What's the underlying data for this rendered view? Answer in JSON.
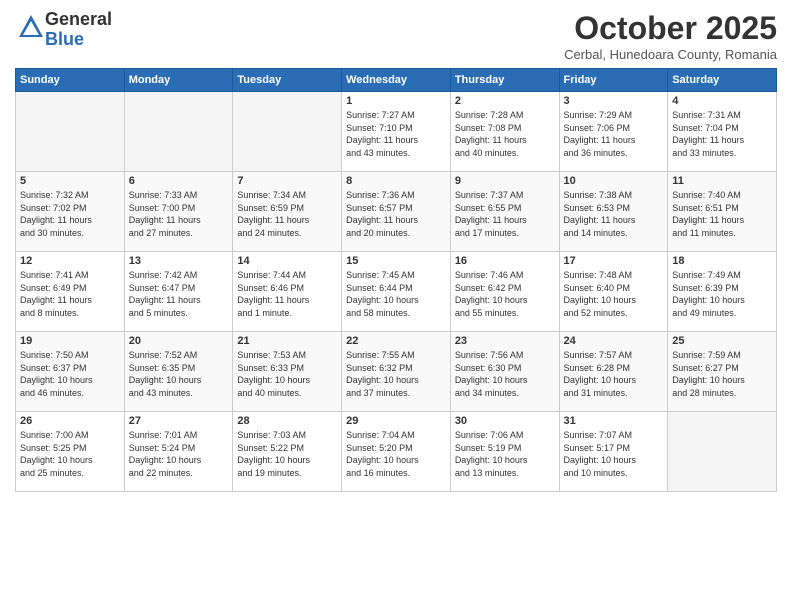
{
  "logo": {
    "general": "General",
    "blue": "Blue"
  },
  "title": "October 2025",
  "subtitle": "Cerbal, Hunedoara County, Romania",
  "headers": [
    "Sunday",
    "Monday",
    "Tuesday",
    "Wednesday",
    "Thursday",
    "Friday",
    "Saturday"
  ],
  "weeks": [
    [
      {
        "num": "",
        "info": ""
      },
      {
        "num": "",
        "info": ""
      },
      {
        "num": "",
        "info": ""
      },
      {
        "num": "1",
        "info": "Sunrise: 7:27 AM\nSunset: 7:10 PM\nDaylight: 11 hours\nand 43 minutes."
      },
      {
        "num": "2",
        "info": "Sunrise: 7:28 AM\nSunset: 7:08 PM\nDaylight: 11 hours\nand 40 minutes."
      },
      {
        "num": "3",
        "info": "Sunrise: 7:29 AM\nSunset: 7:06 PM\nDaylight: 11 hours\nand 36 minutes."
      },
      {
        "num": "4",
        "info": "Sunrise: 7:31 AM\nSunset: 7:04 PM\nDaylight: 11 hours\nand 33 minutes."
      }
    ],
    [
      {
        "num": "5",
        "info": "Sunrise: 7:32 AM\nSunset: 7:02 PM\nDaylight: 11 hours\nand 30 minutes."
      },
      {
        "num": "6",
        "info": "Sunrise: 7:33 AM\nSunset: 7:00 PM\nDaylight: 11 hours\nand 27 minutes."
      },
      {
        "num": "7",
        "info": "Sunrise: 7:34 AM\nSunset: 6:59 PM\nDaylight: 11 hours\nand 24 minutes."
      },
      {
        "num": "8",
        "info": "Sunrise: 7:36 AM\nSunset: 6:57 PM\nDaylight: 11 hours\nand 20 minutes."
      },
      {
        "num": "9",
        "info": "Sunrise: 7:37 AM\nSunset: 6:55 PM\nDaylight: 11 hours\nand 17 minutes."
      },
      {
        "num": "10",
        "info": "Sunrise: 7:38 AM\nSunset: 6:53 PM\nDaylight: 11 hours\nand 14 minutes."
      },
      {
        "num": "11",
        "info": "Sunrise: 7:40 AM\nSunset: 6:51 PM\nDaylight: 11 hours\nand 11 minutes."
      }
    ],
    [
      {
        "num": "12",
        "info": "Sunrise: 7:41 AM\nSunset: 6:49 PM\nDaylight: 11 hours\nand 8 minutes."
      },
      {
        "num": "13",
        "info": "Sunrise: 7:42 AM\nSunset: 6:47 PM\nDaylight: 11 hours\nand 5 minutes."
      },
      {
        "num": "14",
        "info": "Sunrise: 7:44 AM\nSunset: 6:46 PM\nDaylight: 11 hours\nand 1 minute."
      },
      {
        "num": "15",
        "info": "Sunrise: 7:45 AM\nSunset: 6:44 PM\nDaylight: 10 hours\nand 58 minutes."
      },
      {
        "num": "16",
        "info": "Sunrise: 7:46 AM\nSunset: 6:42 PM\nDaylight: 10 hours\nand 55 minutes."
      },
      {
        "num": "17",
        "info": "Sunrise: 7:48 AM\nSunset: 6:40 PM\nDaylight: 10 hours\nand 52 minutes."
      },
      {
        "num": "18",
        "info": "Sunrise: 7:49 AM\nSunset: 6:39 PM\nDaylight: 10 hours\nand 49 minutes."
      }
    ],
    [
      {
        "num": "19",
        "info": "Sunrise: 7:50 AM\nSunset: 6:37 PM\nDaylight: 10 hours\nand 46 minutes."
      },
      {
        "num": "20",
        "info": "Sunrise: 7:52 AM\nSunset: 6:35 PM\nDaylight: 10 hours\nand 43 minutes."
      },
      {
        "num": "21",
        "info": "Sunrise: 7:53 AM\nSunset: 6:33 PM\nDaylight: 10 hours\nand 40 minutes."
      },
      {
        "num": "22",
        "info": "Sunrise: 7:55 AM\nSunset: 6:32 PM\nDaylight: 10 hours\nand 37 minutes."
      },
      {
        "num": "23",
        "info": "Sunrise: 7:56 AM\nSunset: 6:30 PM\nDaylight: 10 hours\nand 34 minutes."
      },
      {
        "num": "24",
        "info": "Sunrise: 7:57 AM\nSunset: 6:28 PM\nDaylight: 10 hours\nand 31 minutes."
      },
      {
        "num": "25",
        "info": "Sunrise: 7:59 AM\nSunset: 6:27 PM\nDaylight: 10 hours\nand 28 minutes."
      }
    ],
    [
      {
        "num": "26",
        "info": "Sunrise: 7:00 AM\nSunset: 5:25 PM\nDaylight: 10 hours\nand 25 minutes."
      },
      {
        "num": "27",
        "info": "Sunrise: 7:01 AM\nSunset: 5:24 PM\nDaylight: 10 hours\nand 22 minutes."
      },
      {
        "num": "28",
        "info": "Sunrise: 7:03 AM\nSunset: 5:22 PM\nDaylight: 10 hours\nand 19 minutes."
      },
      {
        "num": "29",
        "info": "Sunrise: 7:04 AM\nSunset: 5:20 PM\nDaylight: 10 hours\nand 16 minutes."
      },
      {
        "num": "30",
        "info": "Sunrise: 7:06 AM\nSunset: 5:19 PM\nDaylight: 10 hours\nand 13 minutes."
      },
      {
        "num": "31",
        "info": "Sunrise: 7:07 AM\nSunset: 5:17 PM\nDaylight: 10 hours\nand 10 minutes."
      },
      {
        "num": "",
        "info": ""
      }
    ]
  ]
}
